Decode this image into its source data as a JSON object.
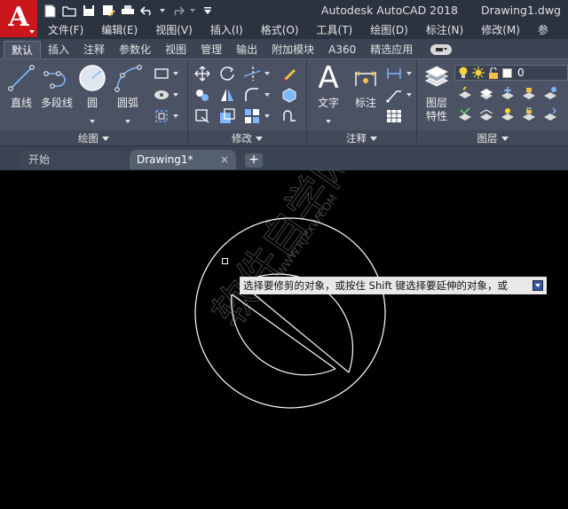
{
  "app": {
    "logo_letter": "A",
    "title": "Autodesk AutoCAD 2018",
    "document": "Drawing1.dwg"
  },
  "quick_access": [
    "new-file-icon",
    "open-folder-icon",
    "save-icon",
    "save-as-icon",
    "print-icon",
    "undo-icon",
    "redo-icon",
    "customize-dropdown-icon"
  ],
  "menubar": [
    "文件(F)",
    "编辑(E)",
    "视图(V)",
    "插入(I)",
    "格式(O)",
    "工具(T)",
    "绘图(D)",
    "标注(N)",
    "修改(M)",
    "参"
  ],
  "ribbon_tabs": [
    "默认",
    "插入",
    "注释",
    "参数化",
    "视图",
    "管理",
    "输出",
    "附加模块",
    "A360",
    "精选应用"
  ],
  "active_ribbon_tab": "默认",
  "panels": {
    "draw": {
      "title": "绘图",
      "buttons": [
        "直线",
        "多段线",
        "圆",
        "圆弧"
      ]
    },
    "modify": {
      "title": "修改"
    },
    "annotation": {
      "title": "注释",
      "buttons": [
        "文字",
        "标注"
      ]
    },
    "layers": {
      "title": "图层",
      "properties_label_1": "图层",
      "properties_label_2": "特性",
      "current_layer": "0"
    }
  },
  "file_tabs": {
    "start": "开始",
    "drawing": "Drawing1*",
    "close": "×",
    "add": "+"
  },
  "canvas": {
    "prompt": "选择要修剪的对象，或按住 Shift 键选择要延伸的对象，或",
    "watermark": "软件自学网",
    "watermark_url": "WWW.RJZXW.COM"
  },
  "colors": {
    "app_red": "#c9171b",
    "title_bg": "#2b3240",
    "ribbon_bg": "#4a5263",
    "canvas_bg": "#000000"
  }
}
